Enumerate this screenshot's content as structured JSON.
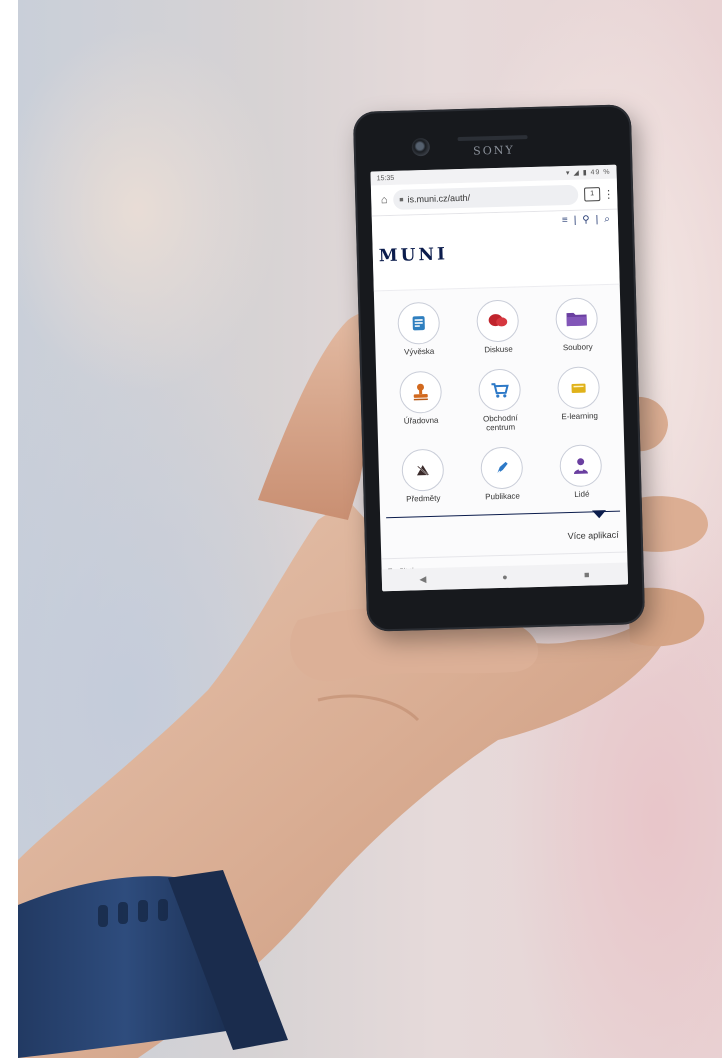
{
  "status_bar": {
    "time": "15:35",
    "battery": "49 %"
  },
  "browser": {
    "url": "is.muni.cz/auth/",
    "tabs_count": "1"
  },
  "site": {
    "logo": "MUNI"
  },
  "apps": [
    {
      "label": "Vývěska",
      "icon": "noticeboard-icon",
      "color": "#2f7fbf"
    },
    {
      "label": "Diskuse",
      "icon": "discussion-icon",
      "color": "#c0242c"
    },
    {
      "label": "Soubory",
      "icon": "folder-icon",
      "color": "#6a3fa0"
    },
    {
      "label": "Úřadovna",
      "icon": "stamp-icon",
      "color": "#d2691e"
    },
    {
      "label": "Obchodní centrum",
      "icon": "cart-icon",
      "color": "#2d79c7"
    },
    {
      "label": "E-learning",
      "icon": "elearning-icon",
      "color": "#e0b21a"
    },
    {
      "label": "Předměty",
      "icon": "subjects-icon",
      "color": "#3a2a2a"
    },
    {
      "label": "Publikace",
      "icon": "pen-icon",
      "color": "#2d79c7"
    },
    {
      "label": "Lidé",
      "icon": "person-icon",
      "color": "#6a3fa0"
    }
  ],
  "more_apps": "Více aplikací",
  "footer": "Zrušit tip",
  "phone_brand": "SONY"
}
